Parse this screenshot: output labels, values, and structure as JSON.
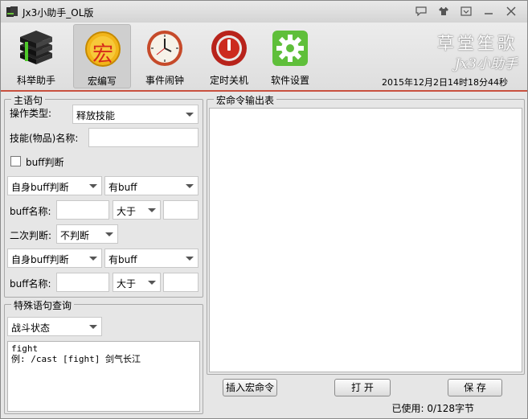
{
  "window": {
    "title": "Jx3小助手_OL版"
  },
  "toolbar": {
    "tools": [
      {
        "label": "科举助手"
      },
      {
        "label": "宏编写",
        "glyph": "宏"
      },
      {
        "label": "事件闹钟"
      },
      {
        "label": "定时关机"
      },
      {
        "label": "软件设置"
      }
    ],
    "brand_line1": "草堂笙歌",
    "brand_line2": "Jx3小助手",
    "datetime": "2015年12月2日14时18分44秒"
  },
  "main_statement": {
    "legend": "主语句",
    "op_type_label": "操作类型:",
    "op_type_value": "释放技能",
    "skill_label": "技能(物品)名称:",
    "skill_value": "",
    "buff_check_label": "buff判断",
    "buff_check_checked": false,
    "buff_row1": {
      "target": "自身buff判断",
      "condition": "有buff"
    },
    "buff_name_label": "buff名称:",
    "compare1": "大于",
    "second_label": "二次判断:",
    "second_value": "不判断",
    "buff_row2": {
      "target": "自身buff判断",
      "condition": "有buff"
    },
    "compare2": "大于"
  },
  "special": {
    "legend": "特殊语句查询",
    "combo_value": "战斗状态",
    "text": "fight\n例: /cast [fight] 剑气长江"
  },
  "output": {
    "legend": "宏命令输出表",
    "content": ""
  },
  "buttons": {
    "insert": "插入宏命令",
    "open": "打 开",
    "save": "保 存"
  },
  "status": {
    "used": "已使用: 0/128字节"
  }
}
